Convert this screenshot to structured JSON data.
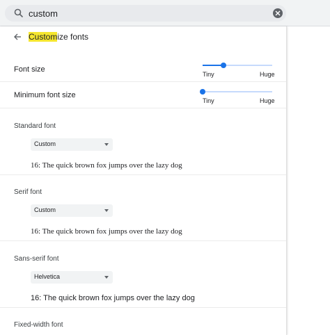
{
  "search": {
    "query": "custom"
  },
  "page": {
    "title_highlight": "Custom",
    "title_rest": "ize fonts"
  },
  "font_size": {
    "label": "Font size",
    "min_label": "Tiny",
    "max_label": "Huge",
    "level": 0.3
  },
  "min_font_size": {
    "label": "Minimum font size",
    "min_label": "Tiny",
    "max_label": "Huge",
    "level": 0.0
  },
  "sections": {
    "standard": {
      "title": "Standard font",
      "selected": "Custom",
      "sample": "16: The quick brown fox jumps over the lazy dog"
    },
    "serif": {
      "title": "Serif font",
      "selected": "Custom",
      "sample": "16: The quick brown fox jumps over the lazy dog"
    },
    "sans": {
      "title": "Sans-serif font",
      "selected": "Helvetica",
      "sample": "16: The quick brown fox jumps over the lazy dog"
    },
    "fixed": {
      "title": "Fixed-width font"
    }
  },
  "colors": {
    "accent": "#1a73e8",
    "highlight": "#f5e62f"
  },
  "icons": {
    "search": "search-icon",
    "clear": "clear-icon",
    "back": "back-arrow-icon"
  }
}
